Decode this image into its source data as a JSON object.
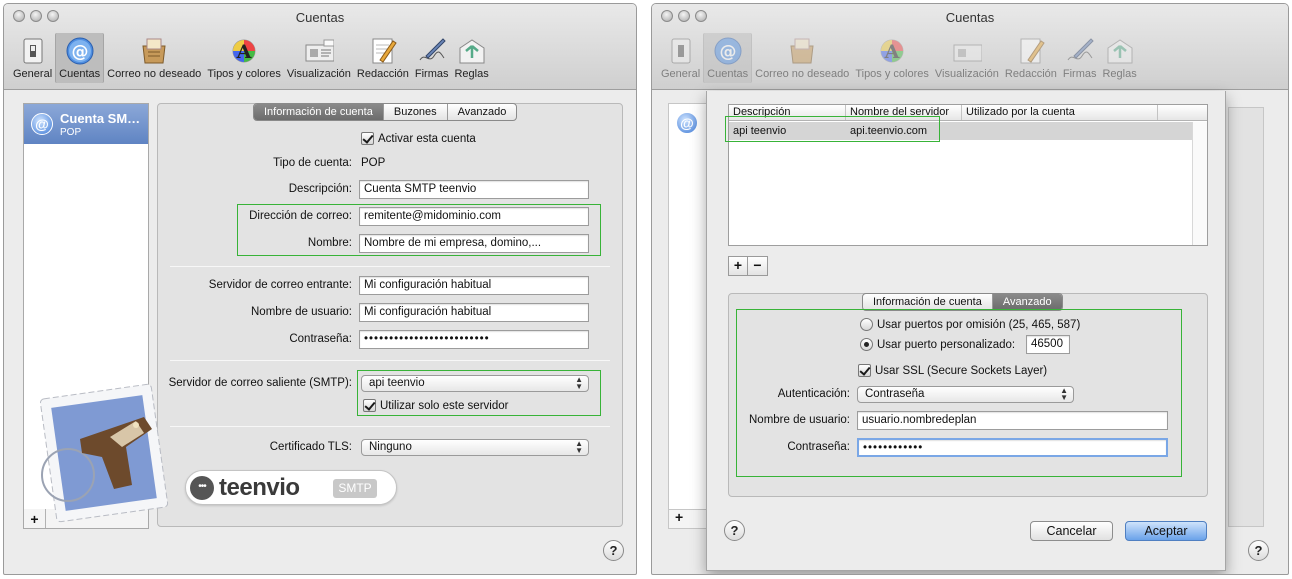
{
  "window_left": {
    "title": "Cuentas",
    "toolbar": [
      {
        "id": "general",
        "label": "General",
        "icon": "switch-icon"
      },
      {
        "id": "accounts",
        "label": "Cuentas",
        "icon": "at-sign-icon",
        "selected": true
      },
      {
        "id": "junk",
        "label": "Correo no deseado",
        "icon": "junk-mail-icon"
      },
      {
        "id": "fonts",
        "label": "Tipos y colores",
        "icon": "fonts-colors-icon"
      },
      {
        "id": "viewing",
        "label": "Visualización",
        "icon": "viewing-icon"
      },
      {
        "id": "composing",
        "label": "Redacción",
        "icon": "composing-icon"
      },
      {
        "id": "signatures",
        "label": "Firmas",
        "icon": "signature-pen-icon"
      },
      {
        "id": "rules",
        "label": "Reglas",
        "icon": "rules-icon"
      }
    ],
    "account": {
      "name": "Cuenta SMTP teenvio",
      "type": "POP"
    },
    "add_label": "+",
    "tabs": {
      "info": "Información de cuenta",
      "mailboxes": "Buzones",
      "advanced": "Avanzado"
    },
    "form": {
      "enable_label": "Activar esta cuenta",
      "account_type_label": "Tipo de cuenta:",
      "account_type_value": "POP",
      "description_label": "Descripción:",
      "description_value": "Cuenta SMTP teenvio",
      "email_label": "Dirección de correo:",
      "email_value": "remitente@midominio.com",
      "name_label": "Nombre:",
      "name_value": "Nombre de mi empresa, domino,...",
      "incoming_label": "Servidor de correo entrante:",
      "incoming_value": "Mi configuración habitual",
      "username_label": "Nombre de usuario:",
      "username_value": "Mi configuración habitual",
      "password_label": "Contraseña:",
      "password_value": "•••••••••••••••••••••••••",
      "smtp_label": "Servidor de correo saliente (SMTP):",
      "smtp_value": "api teenvio",
      "only_server_label": "Utilizar solo este servidor",
      "tls_label": "Certificado TLS:",
      "tls_value": "Ninguno"
    },
    "badge": {
      "brand": "teenvio",
      "tag": "SMTP",
      "dot": "•••"
    },
    "help": "?"
  },
  "window_right": {
    "title": "Cuentas",
    "toolbar": [
      {
        "id": "general",
        "label": "General",
        "icon": "switch-icon"
      },
      {
        "id": "accounts",
        "label": "Cuentas",
        "icon": "at-sign-icon",
        "selected": true
      },
      {
        "id": "junk",
        "label": "Correo no deseado",
        "icon": "junk-mail-icon"
      },
      {
        "id": "fonts",
        "label": "Tipos y colores",
        "icon": "fonts-colors-icon"
      },
      {
        "id": "viewing",
        "label": "Visualización",
        "icon": "viewing-icon"
      },
      {
        "id": "composing",
        "label": "Redacción",
        "icon": "composing-icon"
      },
      {
        "id": "signatures",
        "label": "Firmas",
        "icon": "signature-pen-icon"
      },
      {
        "id": "rules",
        "label": "Reglas",
        "icon": "rules-icon"
      }
    ],
    "table": {
      "columns": [
        "Descripción",
        "Nombre del servidor",
        "Utilizado por la cuenta"
      ],
      "rows": [
        [
          "api teenvio",
          "api.teenvio.com",
          ""
        ]
      ]
    },
    "plus": "+",
    "minus": "−",
    "tabs": {
      "info": "Información de cuenta",
      "advanced": "Avanzado"
    },
    "advanced": {
      "default_ports_label": "Usar puertos por omisión (25, 465, 587)",
      "custom_port_label": "Usar puerto personalizado:",
      "custom_port_value": "46500",
      "ssl_label": "Usar SSL (Secure Sockets Layer)",
      "auth_label": "Autenticación:",
      "auth_value": "Contraseña",
      "username_label": "Nombre de usuario:",
      "username_value": "usuario.nombredeplan",
      "password_label": "Contraseña:",
      "password_value": "••••••••••••"
    },
    "cancel_label": "Cancelar",
    "ok_label": "Aceptar",
    "help": "?",
    "add_label": "+"
  },
  "colors": {
    "highlight_box": "#38b338",
    "selection": "#6a8ccb",
    "default_button": "#6aa2ea"
  }
}
